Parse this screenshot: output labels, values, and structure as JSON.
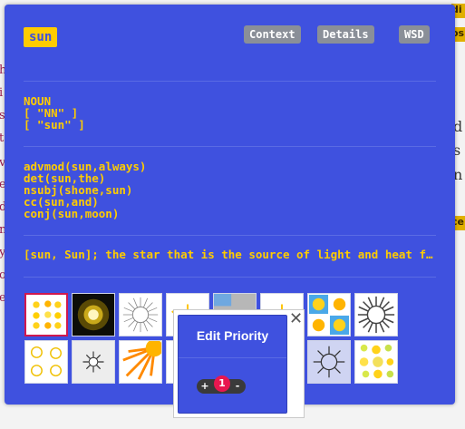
{
  "panel": {
    "word": "sun",
    "buttons": {
      "context": "Context",
      "details": "Details",
      "wsd": "WSD"
    },
    "pos_block": "NOUN\n[ \"NN\" ]\n[ \"sun\" ]",
    "deps_block": "advmod(sun,always)\ndet(sun,the)\nnsubj(shone,sun)\ncc(sun,and)\nconj(sun,moon)",
    "gloss": "[sun, Sun]; the star that is the source of light and heat for the planets in the solar system"
  },
  "images": [
    {
      "icon": "sun-stickers-icon"
    },
    {
      "icon": "glowing-sun-photo-icon"
    },
    {
      "icon": "sunburst-outline-icon"
    },
    {
      "icon": "sun-rays-icon"
    },
    {
      "icon": "sun-sky-photo-icon"
    },
    {
      "icon": "sun-rays-icon"
    },
    {
      "icon": "sun-tiles-icon"
    },
    {
      "icon": "sunburst-badge-icon"
    },
    {
      "icon": "sun-outline-set-icon"
    },
    {
      "icon": "sun-line-icon"
    },
    {
      "icon": "orange-sun-icon"
    },
    {
      "icon": "sun-partial-icon"
    },
    {
      "icon": "sun-partial-icon"
    },
    {
      "icon": "sun-partial-icon"
    },
    {
      "icon": "sun-circle-outline-icon"
    },
    {
      "icon": "sun-cluster-icon"
    }
  ],
  "priority_popup": {
    "title": "Edit Priority",
    "close_icon": "close-icon",
    "increment_label": "+",
    "count": "1",
    "decrement_label": "-"
  },
  "background": {
    "left_letters": [
      "h",
      "i",
      "s",
      "t",
      "v",
      "e",
      "d",
      "n",
      "y",
      "o",
      "e"
    ],
    "right_badges": [
      "di",
      "os",
      "ce"
    ],
    "right_texts": [
      "d",
      "s",
      "n"
    ]
  },
  "colors": {
    "panel": "#3f51df",
    "accent_text": "#ffcc00",
    "selected_border": "#d0184e",
    "count_badge": "#e8174f",
    "button_bg": "#8a8f98"
  }
}
